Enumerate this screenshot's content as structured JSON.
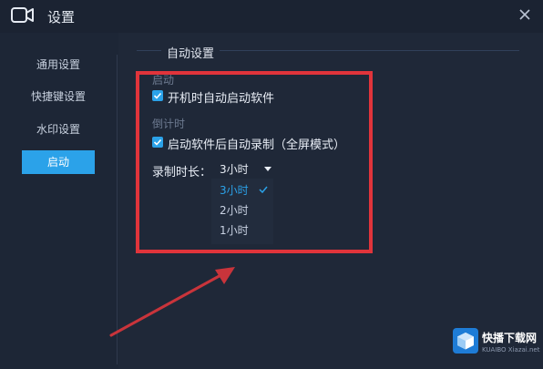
{
  "window": {
    "title": "设置"
  },
  "sidebar": {
    "items": [
      {
        "label": "通用设置",
        "active": false
      },
      {
        "label": "快捷键设置",
        "active": false
      },
      {
        "label": "水印设置",
        "active": false
      },
      {
        "label": "启动",
        "active": true
      }
    ]
  },
  "auto_settings": {
    "group_title": "自动设置",
    "startup_section": "启动",
    "startup_checkbox": {
      "label": "开机时自动启动软件",
      "checked": true
    },
    "timer_section": "倒计时",
    "record_checkbox": {
      "label": "启动软件后自动录制（全屏模式）",
      "checked": true
    },
    "duration": {
      "label": "录制时长：",
      "selected": "3小时",
      "options": [
        "3小时",
        "2小时",
        "1小时"
      ]
    }
  },
  "watermark_logo": {
    "text": "快播下载网",
    "subtext": "KUAIBO Xiazai.net"
  },
  "colors": {
    "accent": "#2ba2e9",
    "highlight": "#e0343b",
    "background": "#1f2838"
  }
}
